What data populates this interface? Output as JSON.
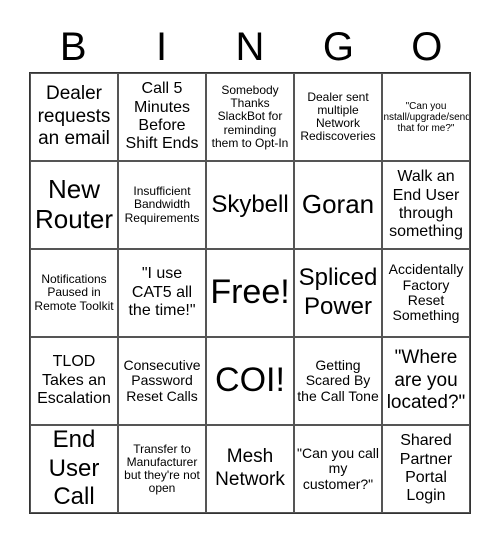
{
  "header": [
    "B",
    "I",
    "N",
    "G",
    "O"
  ],
  "cells": [
    {
      "text": "Dealer requests an email",
      "size": "xl"
    },
    {
      "text": "Call 5 Minutes Before Shift Ends",
      "size": "lg"
    },
    {
      "text": "Somebody Thanks SlackBot for reminding them to Opt-In",
      "size": "sm"
    },
    {
      "text": "Dealer sent multiple Network Rediscoveries",
      "size": "sm"
    },
    {
      "text": "\"Can you install/upgrade/send that for me?\"",
      "size": "xs"
    },
    {
      "text": "New Router",
      "size": "3xl"
    },
    {
      "text": "Insufficient Bandwidth Requirements",
      "size": "sm"
    },
    {
      "text": "Skybell",
      "size": "2xl"
    },
    {
      "text": "Goran",
      "size": "3xl"
    },
    {
      "text": "Walk an End User through something",
      "size": "lg"
    },
    {
      "text": "Notifications Paused in Remote Toolkit",
      "size": "sm"
    },
    {
      "text": "\"I use CAT5 all the time!\"",
      "size": "lg"
    },
    {
      "text": "Free!",
      "size": "4xl"
    },
    {
      "text": "Spliced Power",
      "size": "2xl"
    },
    {
      "text": "Accidentally Factory Reset Something",
      "size": "md"
    },
    {
      "text": "TLOD Takes an Escalation",
      "size": "lg"
    },
    {
      "text": "Consecutive Password Reset Calls",
      "size": "md"
    },
    {
      "text": "COI!",
      "size": "4xl"
    },
    {
      "text": "Getting Scared By the Call Tone",
      "size": "md"
    },
    {
      "text": "\"Where are you located?\"",
      "size": "xl"
    },
    {
      "text": "End User Call",
      "size": "2xl"
    },
    {
      "text": "Transfer to Manufacturer but they're not open",
      "size": "sm"
    },
    {
      "text": "Mesh Network",
      "size": "xl"
    },
    {
      "text": "\"Can you call my customer?\"",
      "size": "md"
    },
    {
      "text": "Shared Partner Portal Login",
      "size": "lg"
    }
  ]
}
